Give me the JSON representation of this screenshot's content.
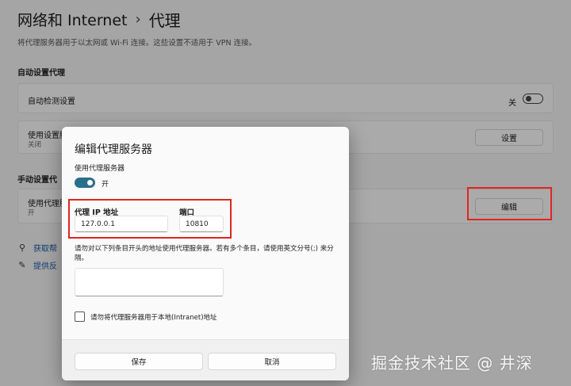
{
  "header": {
    "breadcrumb_parent": "网络和 Internet",
    "breadcrumb_sep": "›",
    "breadcrumb_current": "代理",
    "description": "将代理服务器用于以太网或 Wi-Fi 连接。这些设置不适用于 VPN 连接。"
  },
  "auto_section": {
    "title": "自动设置代理",
    "auto_detect": {
      "label": "自动检测设置",
      "state": "关",
      "on": false
    },
    "setup_script": {
      "label": "使用设置脚",
      "sub": "关闭",
      "button": "设置"
    }
  },
  "manual_section": {
    "title": "手动设置代",
    "use_proxy": {
      "label": "使用代理服",
      "sub": "开",
      "button": "编辑"
    }
  },
  "links": {
    "help": "获取帮",
    "feedback": "提供反"
  },
  "dialog": {
    "title": "编辑代理服务器",
    "use_proxy_label": "使用代理服务器",
    "toggle_state": "开",
    "toggle_on": true,
    "ip_label": "代理 IP 地址",
    "ip_value": "127.0.0.1",
    "port_label": "端口",
    "port_value": "10810",
    "exceptions_note": "请勿对以下列条目开头的地址使用代理服务器。若有多个条目，请使用英文分号(;) 来分隔。",
    "exceptions_value": "",
    "bypass_local_label": "请勿将代理服务器用于本地(Intranet)地址",
    "bypass_local_checked": false,
    "save_label": "保存",
    "cancel_label": "取消"
  },
  "watermark": "掘金技术社区 @ 井深",
  "colors": {
    "accent": "#2a6f8a",
    "highlight": "#e0261f"
  }
}
